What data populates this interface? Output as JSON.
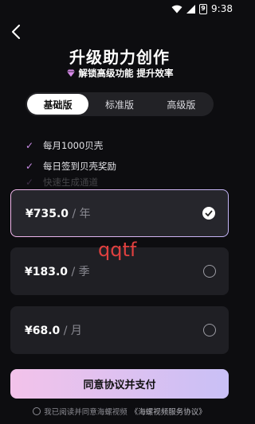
{
  "status_bar": {
    "time": "9:38",
    "battery_level": "9"
  },
  "header": {
    "title": "升级助力创作",
    "subtitle_prefix": "解锁高级功能",
    "subtitle_suffix": "提升效率"
  },
  "tabs": [
    {
      "label": "基础版",
      "active": true
    },
    {
      "label": "标准版",
      "active": false
    },
    {
      "label": "高级版",
      "active": false
    }
  ],
  "features": [
    {
      "text": "每月1000贝壳"
    },
    {
      "text": "每日签到贝壳奖励"
    },
    {
      "text": "快速生成通道"
    }
  ],
  "plans": [
    {
      "price": "¥735.0",
      "sep": " / ",
      "unit": "年",
      "selected": true
    },
    {
      "price": "¥183.0",
      "sep": " / ",
      "unit": "季",
      "selected": false
    },
    {
      "price": "¥68.0",
      "sep": " / ",
      "unit": "月",
      "selected": false
    }
  ],
  "watermark": "qqtf",
  "pay_button": {
    "label": "同意协议并支付"
  },
  "agreement": {
    "prefix": "我已阅读并同意海螺视频",
    "link": "《海螺视频服务协议》"
  },
  "colors": {
    "accent": "#c98be6",
    "background": "#0d0d10",
    "card": "#1f1f24"
  },
  "icons": [
    "wifi-icon",
    "signal-icon",
    "battery-icon",
    "back-icon",
    "diamond-icon",
    "check-icon",
    "radio-icon"
  ]
}
